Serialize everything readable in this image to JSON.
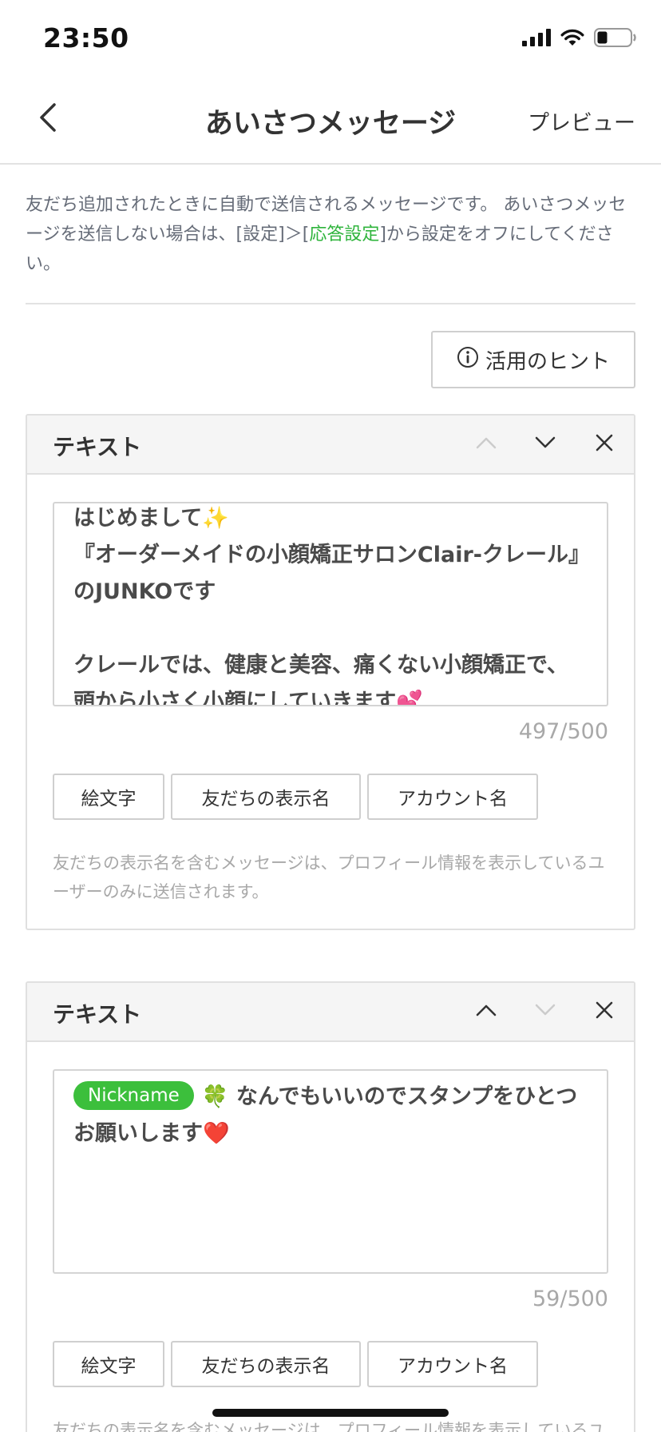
{
  "status": {
    "time": "23:50",
    "icons": [
      "signal-icon",
      "wifi-icon",
      "battery-icon"
    ]
  },
  "nav": {
    "back_icon": "chevron-left-icon",
    "title": "あいさつメッセージ",
    "preview_label": "プレビュー"
  },
  "description": {
    "text_before": "友だち追加されたときに自動で送信されるメッセージです。 あいさつメッセージを送信しない場合は、[設定]＞[",
    "link": "応答設定",
    "text_after": "]から設定をオフにしてください。"
  },
  "hint_button": {
    "icon": "info-circle-icon",
    "label": "活用のヒント"
  },
  "cards": [
    {
      "title": "テキスト",
      "up_enabled": false,
      "down_enabled": true,
      "message": "はじめまして✨\n『オーダーメイドの小顔矯正サロンClair-クレール』のJUNKOです\n\nクレールでは、健康と美容、痛くない小顔矯正で、頭から小さく小顔にしていきます💕",
      "counter": "497/500",
      "buttons": [
        "絵文字",
        "友だちの表示名",
        "アカウント名"
      ],
      "note": "友だちの表示名を含むメッセージは、プロフィール情報を表示しているユーザーのみに送信されます。"
    },
    {
      "title": "テキスト",
      "up_enabled": true,
      "down_enabled": false,
      "nickname_chip": "Nickname",
      "message": "🍀 なんでもいいのでスタンプをひとつお願いします❤️",
      "counter": "59/500",
      "buttons": [
        "絵文字",
        "友だちの表示名",
        "アカウント名"
      ],
      "note": "友だちの表示名を含むメッセージは、プロフィール情報を表示しているユーザーのみに送信されます。"
    }
  ],
  "colors": {
    "accent_green": "#3cbf3c",
    "link_green": "#2fb43c",
    "text_main": "#333333",
    "text_muted": "#a8a8a8"
  }
}
